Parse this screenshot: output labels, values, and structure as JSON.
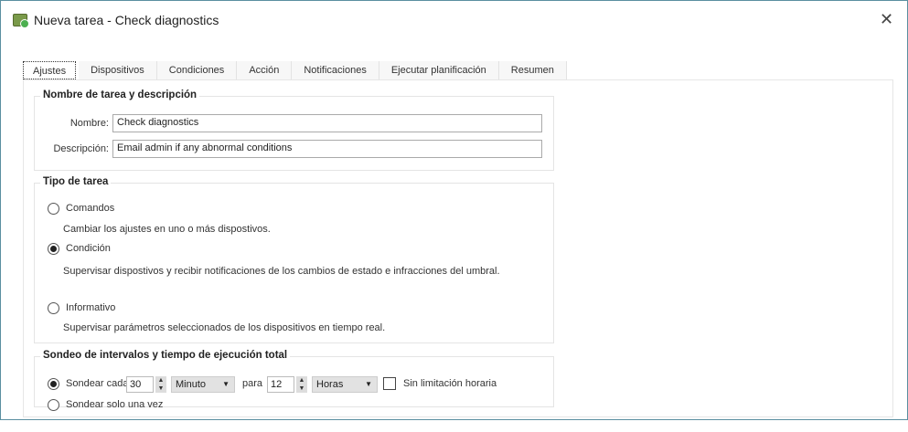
{
  "window": {
    "title": "Nueva tarea - Check diagnostics",
    "close_label": "✕"
  },
  "tabs": [
    "Ajustes",
    "Dispositivos",
    "Condiciones",
    "Acción",
    "Notificaciones",
    "Ejecutar planificación",
    "Resumen"
  ],
  "name_group": {
    "title": "Nombre de tarea y descripción",
    "name_label": "Nombre:",
    "name_value": "Check diagnostics",
    "desc_label": "Descripción:",
    "desc_value": "Email admin if any abnormal conditions"
  },
  "type_group": {
    "title": "Tipo de tarea",
    "options": [
      {
        "label": "Comandos",
        "desc": "Cambiar los ajustes en uno o más dispostivos.",
        "selected": false
      },
      {
        "label": "Condición",
        "desc": "Supervisar dispostivos y recibir notificaciones de los cambios de estado e infracciones del umbral.",
        "selected": true
      },
      {
        "label": "Informativo",
        "desc": "Supervisar parámetros seleccionados de los dispositivos en tiempo real.",
        "selected": false
      }
    ]
  },
  "poll_group": {
    "title": "Sondeo de intervalos y tiempo de ejecución total",
    "every_label": "Sondear cada",
    "every_value": "30",
    "every_unit": "Minuto",
    "for_label": "para",
    "for_value": "12",
    "for_unit": "Horas",
    "no_limit_label": "Sin limitación horaria",
    "no_limit_checked": false,
    "once_label": "Sondear solo una vez",
    "mode": "every"
  }
}
